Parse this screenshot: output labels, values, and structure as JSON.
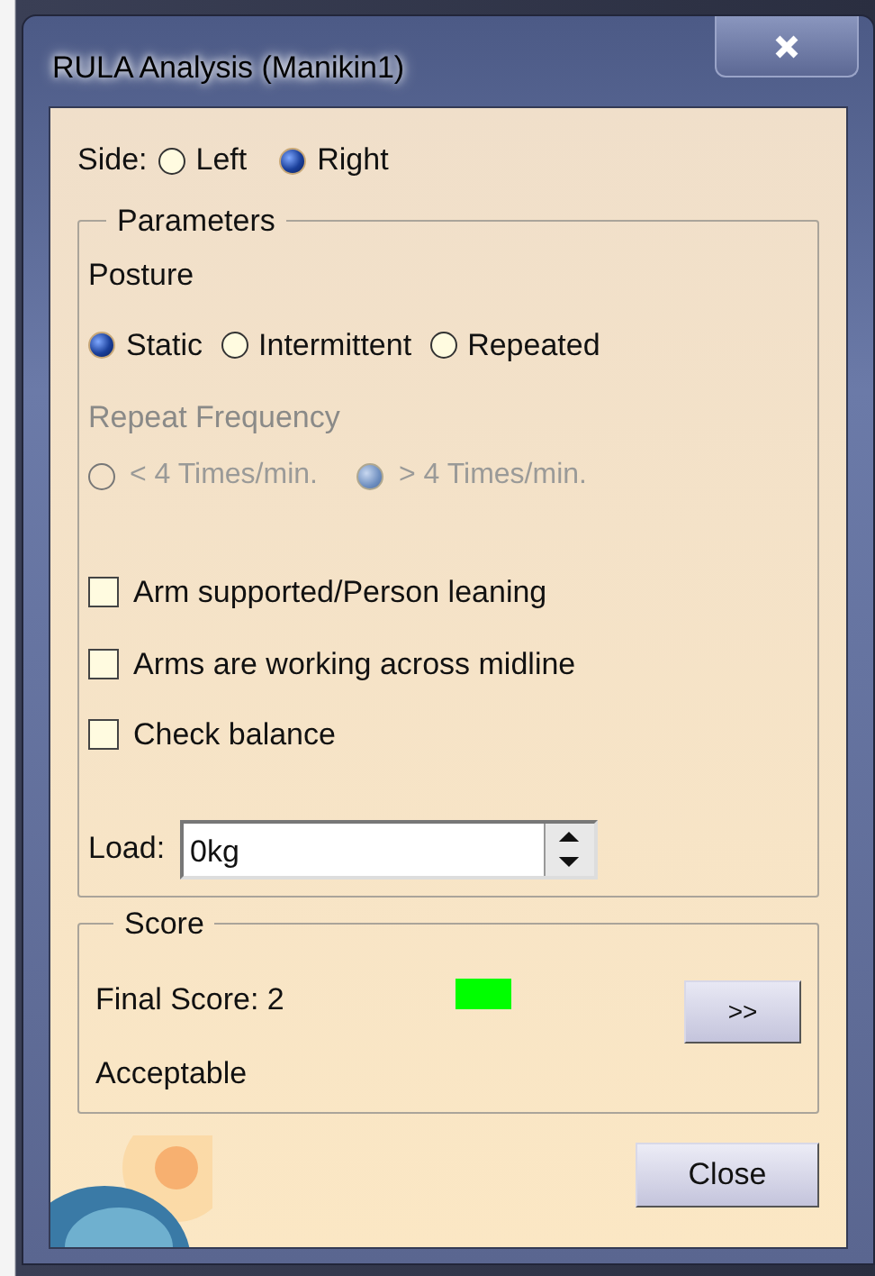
{
  "window": {
    "title": "RULA Analysis (Manikin1)"
  },
  "side": {
    "label": "Side:",
    "options": [
      {
        "label": "Left",
        "selected": false
      },
      {
        "label": "Right",
        "selected": true
      }
    ]
  },
  "parameters": {
    "title": "Parameters",
    "posture_label": "Posture",
    "posture_options": [
      {
        "label": "Static",
        "selected": true
      },
      {
        "label": "Intermittent",
        "selected": false
      },
      {
        "label": "Repeated",
        "selected": false
      }
    ],
    "frequency": {
      "label": "Repeat Frequency",
      "disabled": true,
      "options": [
        {
          "label": "< 4 Times/min.",
          "selected": false
        },
        {
          "label": "> 4 Times/min.",
          "selected": true
        }
      ]
    },
    "checkboxes": [
      {
        "label": "Arm supported/Person leaning",
        "checked": false
      },
      {
        "label": "Arms are working across midline",
        "checked": false
      },
      {
        "label": "Check balance",
        "checked": false
      }
    ],
    "load": {
      "label": "Load:",
      "value": "0kg"
    }
  },
  "score": {
    "title": "Score",
    "final_score": "Final Score: 2",
    "indicator": {
      "color": "#00ff00"
    },
    "verdict": "Acceptable",
    "details_button": ">>"
  },
  "close_button": "Close"
}
